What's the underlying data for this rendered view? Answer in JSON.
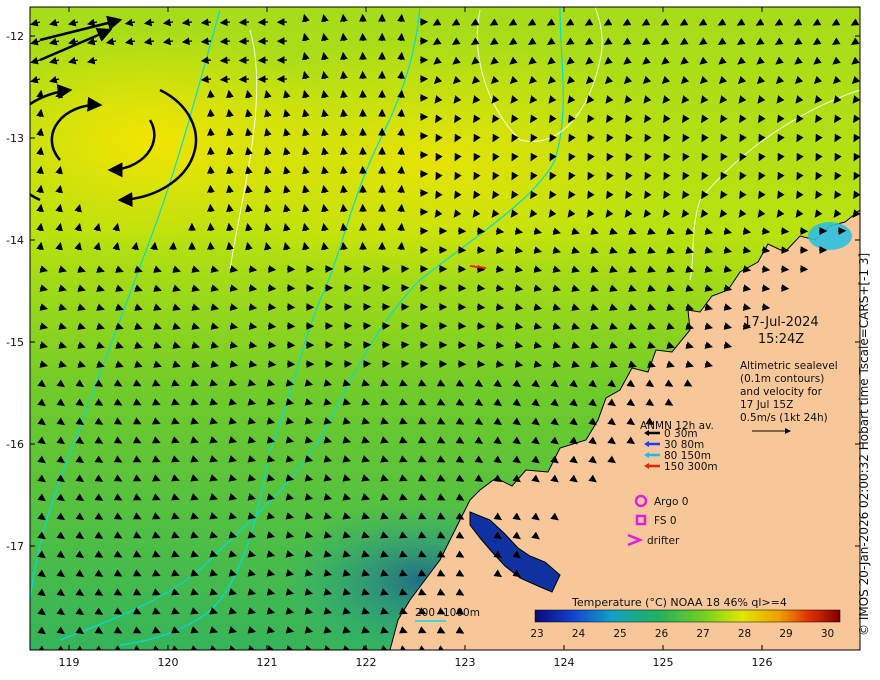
{
  "x_ticks": [
    "119",
    "120",
    "121",
    "122",
    "123",
    "124",
    "125",
    "126"
  ],
  "y_ticks": [
    "-12",
    "-13",
    "-14",
    "-15",
    "-16",
    "-17"
  ],
  "datetime": {
    "date": "17-Jul-2024",
    "time": "15:24Z"
  },
  "altimetry": {
    "line1": "Altimetric sealevel",
    "line2": "(0.1m contours)",
    "line3": "and velocity for",
    "line4": "17 Jul 15Z",
    "line5": "0.5m/s (1kt 24h)"
  },
  "anmn": {
    "title": "ANMN 12h av.",
    "items": [
      {
        "label": "0 30m",
        "color": "#000000"
      },
      {
        "label": "30 80m",
        "color": "#1e3cff"
      },
      {
        "label": "80 150m",
        "color": "#22bbee"
      },
      {
        "label": "150 300m",
        "color": "#ee2200"
      }
    ]
  },
  "platforms": {
    "argo": "Argo 0",
    "fs": "FS 0",
    "drifter": "drifter",
    "color": "#e020e0"
  },
  "bathymetry": {
    "label1": "200",
    "label2": "1000m",
    "color": "#00dddd"
  },
  "colorbar": {
    "title": "Temperature (°C) NOAA 18 46% ql>=4",
    "ticks": [
      "23",
      "24",
      "25",
      "26",
      "27",
      "28",
      "29",
      "30"
    ]
  },
  "copyright": "© IMOS 20-Jan-2026 02:00:32 Hobart time Tscale=CARS+[-1 3]",
  "colors": {
    "land": "#f7c79a",
    "ocean_warm": "#c8e800",
    "ocean_cool": "#2fbb55"
  }
}
